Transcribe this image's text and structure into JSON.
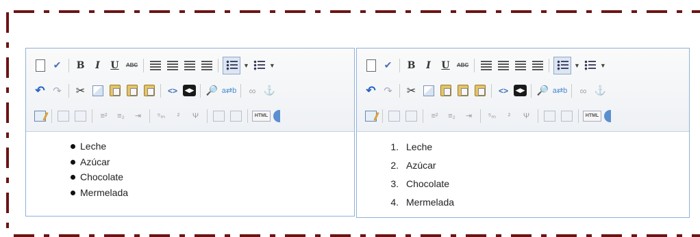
{
  "frame": {
    "border_color": "#6b1414"
  },
  "toolbar": {
    "row1_icons": [
      "new-page-icon",
      "spellcheck-icon",
      "bold-icon",
      "italic-icon",
      "underline-icon",
      "strikethrough-icon",
      "align-left-icon",
      "align-center-icon",
      "align-right-icon",
      "align-justify-icon",
      "bulleted-list-icon",
      "numbered-list-icon"
    ],
    "row2_icons": [
      "undo-icon",
      "redo-icon",
      "cut-icon",
      "copy-icon",
      "paste-icon",
      "paste-text-icon",
      "paste-word-icon",
      "source-code-icon",
      "show-blocks-icon",
      "find-icon",
      "replace-icon",
      "link-icon",
      "anchor-icon"
    ],
    "row3_icons": [
      "edit-icon",
      "table-icon",
      "cell-icon",
      "superscript-icon",
      "subscript-icon",
      "indent-icon",
      "fraction-icon",
      "symbol-icon",
      "grid-icon",
      "html-icon"
    ],
    "bold": "B",
    "italic": "I",
    "underline": "U",
    "strike": "ABC",
    "html": "HTML",
    "accent_color": "#5a8fd0"
  },
  "left_editor": {
    "list_type": "bulleted",
    "items": [
      "Leche",
      "Azúcar",
      "Chocolate",
      "Mermelada"
    ]
  },
  "right_editor": {
    "list_type": "numbered",
    "items": [
      {
        "n": "1.",
        "text": "Leche"
      },
      {
        "n": "2.",
        "text": "Azúcar"
      },
      {
        "n": "3.",
        "text": "Chocolate"
      },
      {
        "n": "4.",
        "text": "Mermelada"
      }
    ]
  }
}
